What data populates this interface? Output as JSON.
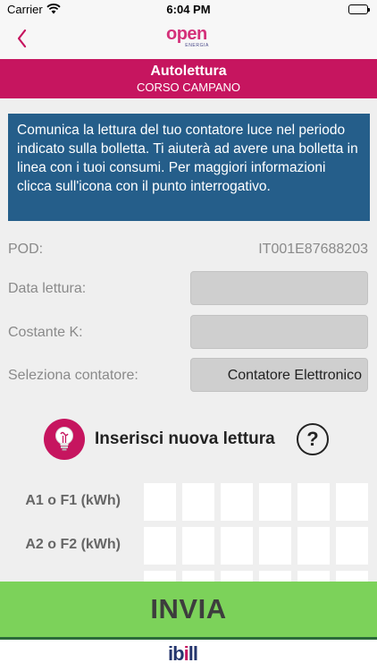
{
  "status_bar": {
    "carrier": "Carrier",
    "time": "6:04 PM",
    "battery_level": 1.0
  },
  "nav": {
    "back_icon": "chevron-left-icon",
    "logo_text": "open",
    "logo_subtext": "ENERGIA"
  },
  "header": {
    "title": "Autolettura",
    "subtitle": "CORSO CAMPANO"
  },
  "info_text": "Comunica la lettura del tuo contatore luce nel periodo indicato sulla bolletta. Ti aiuterà ad avere una bolletta in linea con i tuoi consumi. Per maggiori informazioni clicca sull'icona con il punto interrogativo.",
  "form": {
    "pod_label": "POD:",
    "pod_value": "IT001E87688203",
    "data_lettura_label": "Data lettura:",
    "data_lettura_value": "",
    "costante_label": "Costante K:",
    "costante_value": "",
    "contatore_label": "Seleziona contatore:",
    "contatore_value": "Contatore Elettronico"
  },
  "reading": {
    "title": "Inserisci nuova lettura",
    "icon": "lightbulb-icon",
    "help_icon": "question-icon",
    "help_symbol": "?",
    "rows": [
      {
        "label": "A1 o F1 (kWh)"
      },
      {
        "label": "A2 o F2 (kWh)"
      }
    ]
  },
  "send_label": "INVIA",
  "footer": {
    "brand_prefix": "i",
    "brand_mid": "b",
    "brand_dot": "i",
    "brand_suffix": "ll"
  },
  "colors": {
    "brand_magenta": "#c6155f",
    "info_blue": "#255e8a",
    "send_green": "#7cd25a",
    "footer_navy": "#24356d"
  }
}
